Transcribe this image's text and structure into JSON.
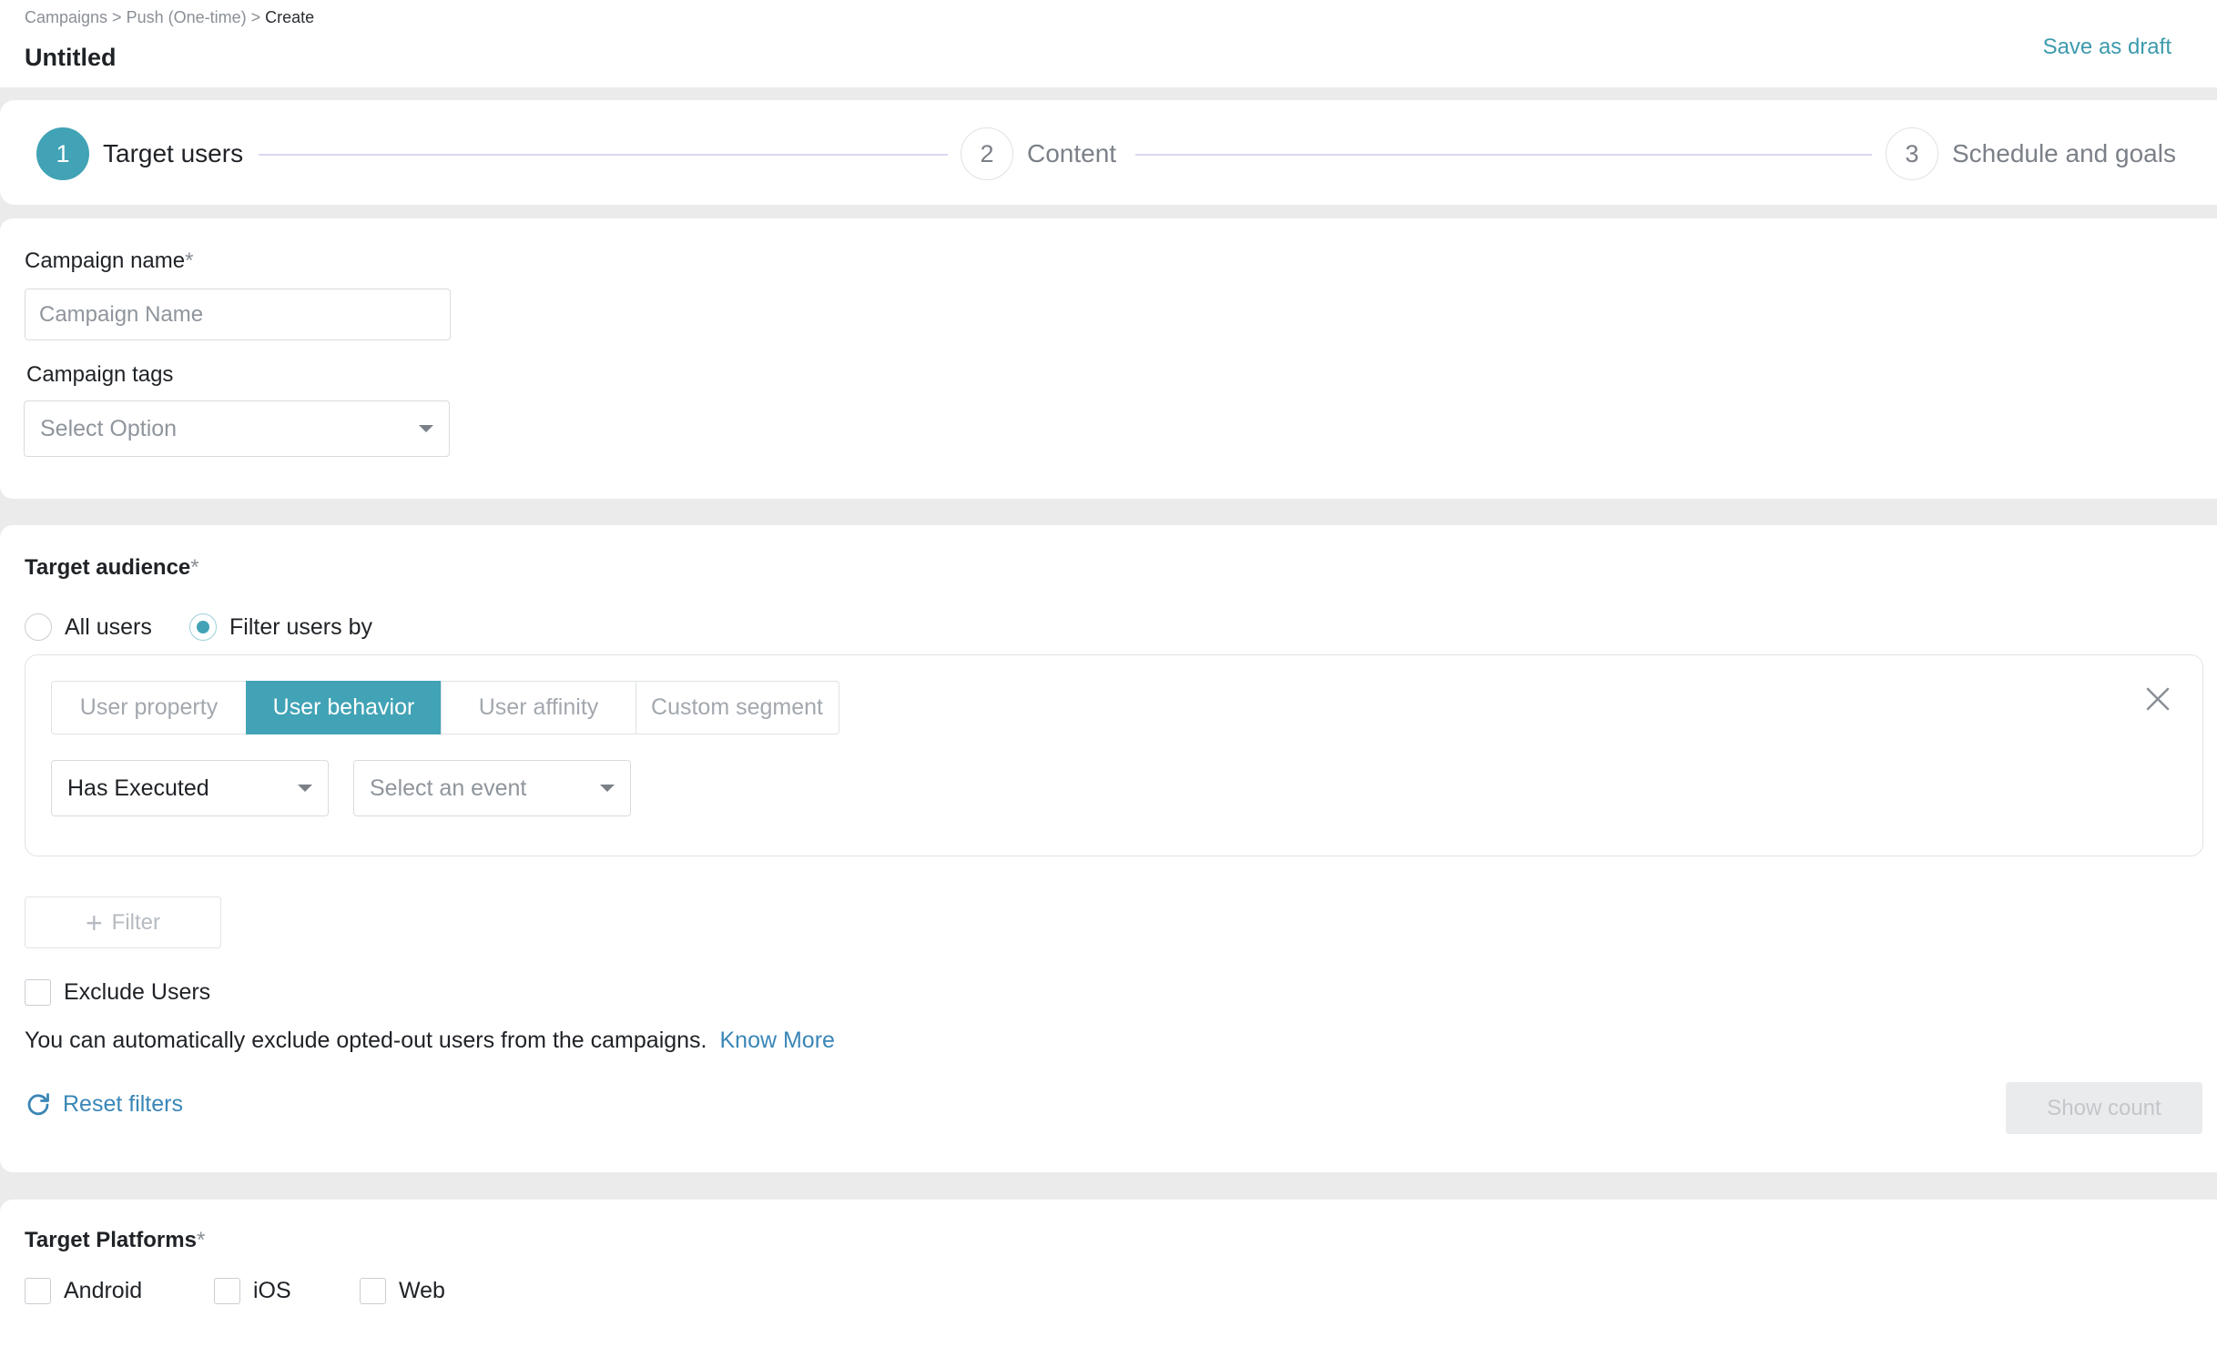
{
  "header": {
    "breadcrumb": [
      "Campaigns",
      "Push (One-time)",
      "Create"
    ],
    "separator": ">",
    "title": "Untitled",
    "save_draft_label": "Save as draft"
  },
  "stepper": {
    "steps": [
      {
        "number": "1",
        "label": "Target users",
        "active": true
      },
      {
        "number": "2",
        "label": "Content",
        "active": false
      },
      {
        "number": "3",
        "label": "Schedule and goals",
        "active": false
      }
    ]
  },
  "campaign": {
    "name_label": "Campaign name",
    "name_required": "*",
    "name_placeholder": "Campaign Name",
    "name_value": "",
    "tags_label": "Campaign tags",
    "tags_placeholder": "Select Option"
  },
  "audience": {
    "title": "Target audience",
    "required": "*",
    "options": [
      {
        "label": "All users",
        "checked": false
      },
      {
        "label": "Filter users by",
        "checked": true
      }
    ],
    "tabs": [
      {
        "label": "User property",
        "active": false
      },
      {
        "label": "User behavior",
        "active": true
      },
      {
        "label": "User affinity",
        "active": false
      },
      {
        "label": "Custom segment",
        "active": false
      }
    ],
    "condition_value": "Has Executed",
    "event_placeholder": "Select an event",
    "add_filter_label": "Filter",
    "exclude_label": "Exclude Users",
    "exclude_checked": false,
    "info_text": "You can automatically exclude opted-out users from the campaigns.",
    "know_more_label": "Know More",
    "reset_label": "Reset filters",
    "show_count_label": "Show count"
  },
  "platforms": {
    "title": "Target Platforms",
    "required": "*",
    "items": [
      {
        "label": "Android",
        "checked": false
      },
      {
        "label": "iOS",
        "checked": false
      },
      {
        "label": "Web",
        "checked": false
      }
    ]
  },
  "colors": {
    "accent": "#41a3b5",
    "link": "#3a86b7",
    "save_draft": "#3c9aac",
    "page_bg": "#ebebeb"
  }
}
